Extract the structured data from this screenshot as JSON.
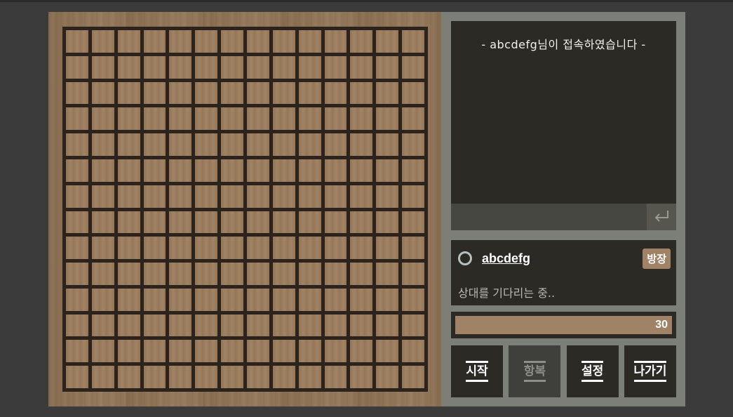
{
  "chat": {
    "system_message": "- abcdefg님이 접속하였습니다 -",
    "input_value": "",
    "enter_icon": "enter-return-icon"
  },
  "player": {
    "stone_icon": "white-stone-icon",
    "name": "abcdefg",
    "host_badge": "방장",
    "status": "상대를 기다리는 중.."
  },
  "timer": {
    "value": "30",
    "fill_fraction": 1.0
  },
  "actions": {
    "start": "시작",
    "surrender": "항복",
    "settings": "설정",
    "exit": "나가기"
  },
  "board": {
    "cells_per_side": 14
  },
  "colors": {
    "accent": "#a08266",
    "panel": "#2b2a25",
    "frame": "#7c7f78"
  }
}
